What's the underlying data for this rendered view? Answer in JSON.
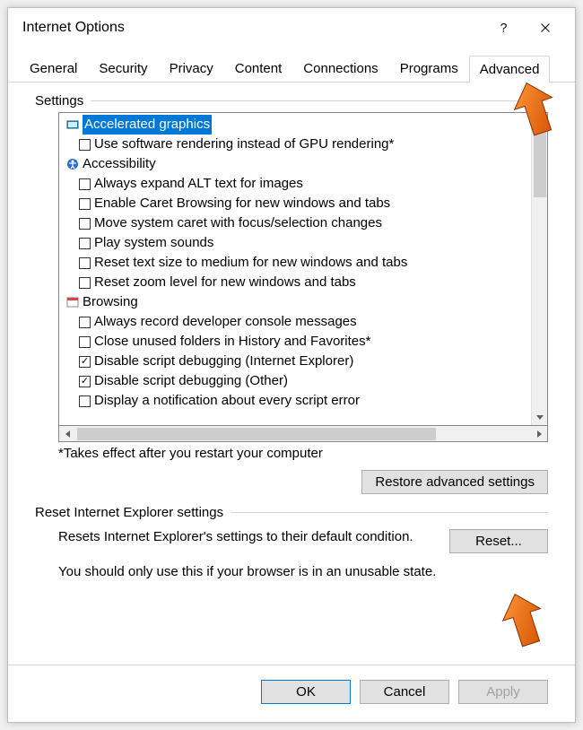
{
  "title": "Internet Options",
  "tabs": [
    "General",
    "Security",
    "Privacy",
    "Content",
    "Connections",
    "Programs",
    "Advanced"
  ],
  "active_tab": 6,
  "settings_label": "Settings",
  "tree": [
    {
      "type": "category",
      "icon": "graphics",
      "label": "Accelerated graphics",
      "selected": true
    },
    {
      "type": "item",
      "checked": false,
      "label": "Use software rendering instead of GPU rendering*"
    },
    {
      "type": "category",
      "icon": "accessibility",
      "label": "Accessibility"
    },
    {
      "type": "item",
      "checked": false,
      "label": "Always expand ALT text for images"
    },
    {
      "type": "item",
      "checked": false,
      "label": "Enable Caret Browsing for new windows and tabs"
    },
    {
      "type": "item",
      "checked": false,
      "label": "Move system caret with focus/selection changes"
    },
    {
      "type": "item",
      "checked": false,
      "label": "Play system sounds"
    },
    {
      "type": "item",
      "checked": false,
      "label": "Reset text size to medium for new windows and tabs"
    },
    {
      "type": "item",
      "checked": false,
      "label": "Reset zoom level for new windows and tabs"
    },
    {
      "type": "category",
      "icon": "browsing",
      "label": "Browsing"
    },
    {
      "type": "item",
      "checked": false,
      "label": "Always record developer console messages"
    },
    {
      "type": "item",
      "checked": false,
      "label": "Close unused folders in History and Favorites*"
    },
    {
      "type": "item",
      "checked": true,
      "label": "Disable script debugging (Internet Explorer)"
    },
    {
      "type": "item",
      "checked": true,
      "label": "Disable script debugging (Other)"
    },
    {
      "type": "item",
      "checked": false,
      "label": "Display a notification about every script error"
    }
  ],
  "restart_note": "*Takes effect after you restart your computer",
  "restore_btn": "Restore advanced settings",
  "reset_section_label": "Reset Internet Explorer settings",
  "reset_desc": "Resets Internet Explorer's settings to their default condition.",
  "reset_btn": "Reset...",
  "reset_warn": "You should only use this if your browser is in an unusable state.",
  "ok": "OK",
  "cancel": "Cancel",
  "apply": "Apply"
}
